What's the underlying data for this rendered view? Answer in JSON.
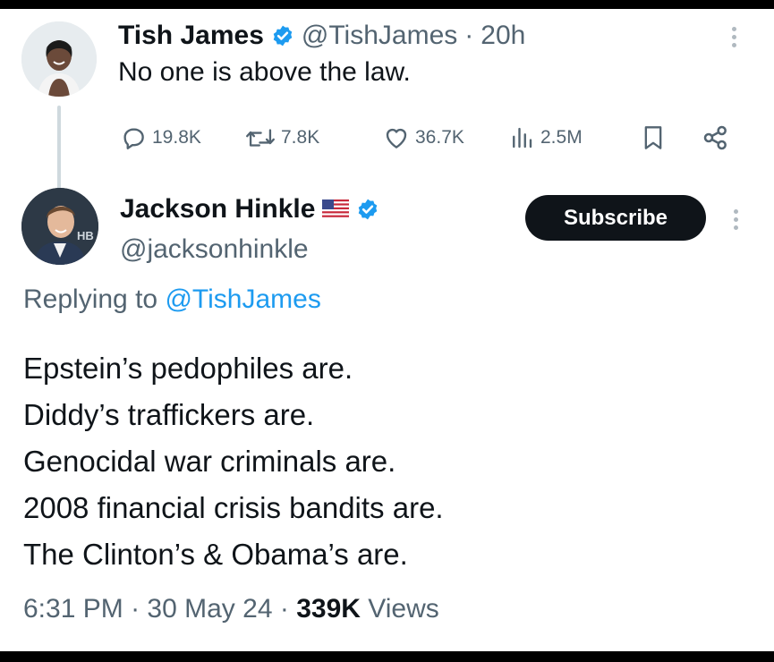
{
  "original_tweet": {
    "author_name": "Tish James",
    "handle": "@TishJames",
    "separator": "·",
    "time_ago": "20h",
    "text": "No one is above the law.",
    "actions": {
      "replies": "19.8K",
      "reposts": "7.8K",
      "likes": "36.7K",
      "views": "2.5M"
    },
    "icons": [
      "verified-badge-icon",
      "more-icon",
      "reply-icon",
      "repost-icon",
      "like-icon",
      "views-icon",
      "bookmark-icon",
      "share-icon"
    ]
  },
  "reply_tweet": {
    "author_name": "Jackson Hinkle",
    "handle": "@jacksonhinkle",
    "flag": "us-flag",
    "subscribe_label": "Subscribe",
    "replying_prefix": "Replying to",
    "replying_handle": "@TishJames",
    "lines": [
      "Epstein’s pedophiles are.",
      "Diddy’s traffickers are.",
      "Genocidal war criminals are.",
      "2008 financial crisis bandits are.",
      "The Clinton’s & Obama’s are."
    ],
    "time": "6:31 PM",
    "date": "30 May 24",
    "views_count": "339K",
    "views_label": "Views",
    "separator": "·"
  },
  "colors": {
    "text": "#0f1419",
    "secondary": "#536471",
    "link": "#1d9bf0",
    "verified": "#1d9bf0",
    "subscribe_bg": "#0f1419"
  }
}
